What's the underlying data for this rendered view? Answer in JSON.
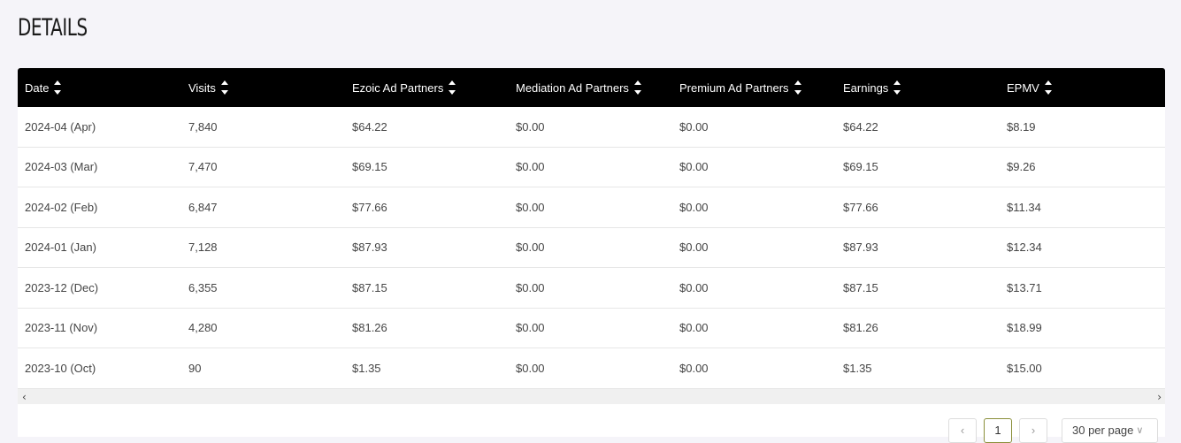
{
  "page": {
    "title": "DETAILS"
  },
  "table": {
    "columns": [
      "Date",
      "Visits",
      "Ezoic Ad Partners",
      "Mediation Ad Partners",
      "Premium Ad Partners",
      "Earnings",
      "EPMV"
    ],
    "rows": [
      [
        "2024-04 (Apr)",
        "7,840",
        "$64.22",
        "$0.00",
        "$0.00",
        "$64.22",
        "$8.19"
      ],
      [
        "2024-03 (Mar)",
        "7,470",
        "$69.15",
        "$0.00",
        "$0.00",
        "$69.15",
        "$9.26"
      ],
      [
        "2024-02 (Feb)",
        "6,847",
        "$77.66",
        "$0.00",
        "$0.00",
        "$77.66",
        "$11.34"
      ],
      [
        "2024-01 (Jan)",
        "7,128",
        "$87.93",
        "$0.00",
        "$0.00",
        "$87.93",
        "$12.34"
      ],
      [
        "2023-12 (Dec)",
        "6,355",
        "$87.15",
        "$0.00",
        "$0.00",
        "$87.15",
        "$13.71"
      ],
      [
        "2023-11 (Nov)",
        "4,280",
        "$81.26",
        "$0.00",
        "$0.00",
        "$81.26",
        "$18.99"
      ],
      [
        "2023-10 (Oct)",
        "90",
        "$1.35",
        "$0.00",
        "$0.00",
        "$1.35",
        "$15.00"
      ]
    ]
  },
  "scroll": {
    "left": "‹",
    "right": "›"
  },
  "pagination": {
    "prev": "‹",
    "current": "1",
    "next": "›",
    "per_page": "30 per page"
  },
  "colors": {
    "header_bg": "#000000",
    "page_bg": "#f5f4f9",
    "active_page_border": "#8a8f3a"
  }
}
